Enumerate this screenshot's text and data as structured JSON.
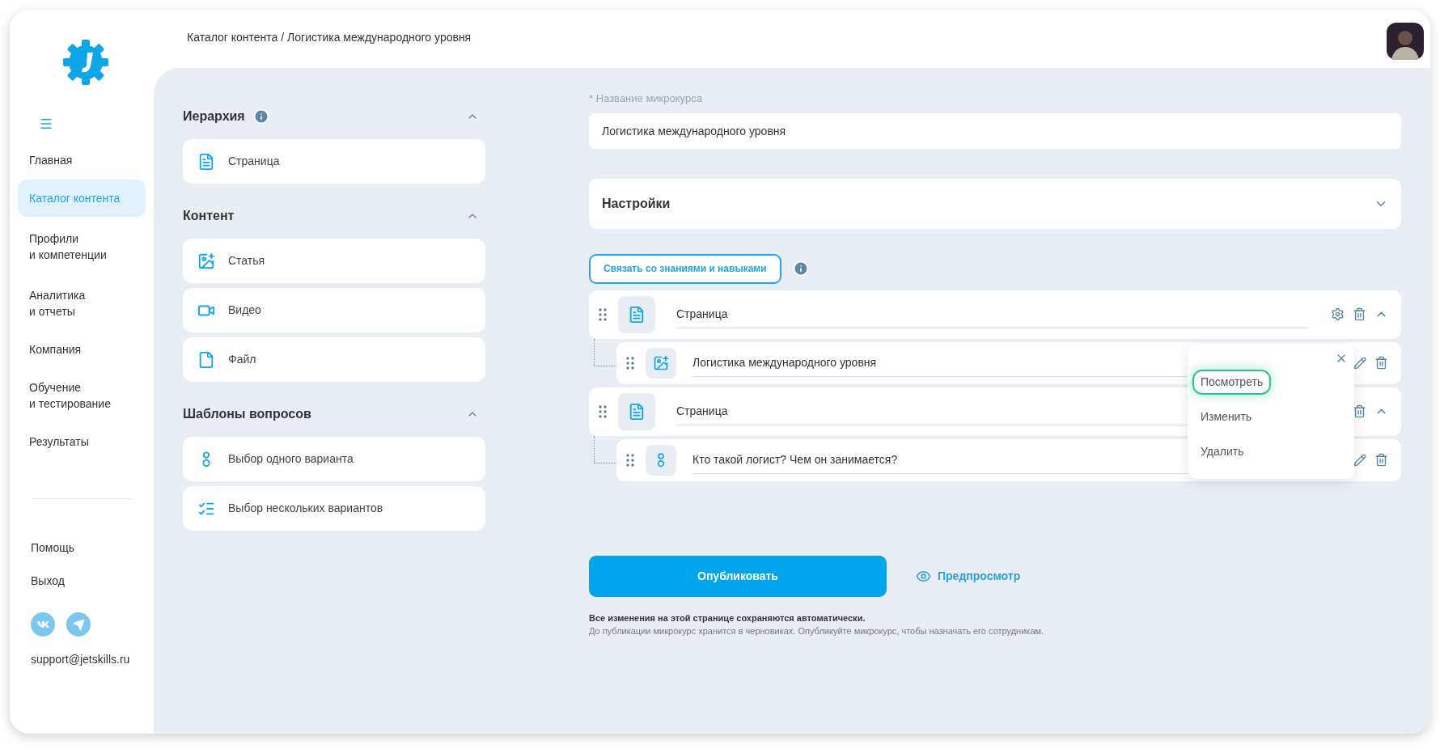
{
  "sidebar": {
    "menu": [
      {
        "label": "Главная",
        "selected": false
      },
      {
        "label": "Каталог контента",
        "selected": true
      },
      {
        "label": "Профили\nи компетенции",
        "selected": false
      },
      {
        "label": "Аналитика\nи отчеты",
        "selected": false
      },
      {
        "label": "Компания",
        "selected": false
      },
      {
        "label": "Обучение\nи тестирование",
        "selected": false
      },
      {
        "label": "Результаты",
        "selected": false
      }
    ],
    "footer_links": [
      "Помощь",
      "Выход"
    ],
    "email": "support@jetskills.ru"
  },
  "breadcrumb": "Каталог контента / Логистика международного уровня",
  "palette": [
    {
      "title": "Иерархия",
      "info": true,
      "expanded": true,
      "items": [
        {
          "label": "Страница",
          "kind": "page"
        }
      ]
    },
    {
      "title": "Контент",
      "info": false,
      "expanded": true,
      "items": [
        {
          "label": "Статья",
          "kind": "article"
        },
        {
          "label": "Видео",
          "kind": "video"
        },
        {
          "label": "Файл",
          "kind": "file"
        }
      ]
    },
    {
      "title": "Шаблоны вопросов",
      "info": false,
      "expanded": true,
      "items": [
        {
          "label": "Выбор одного варианта",
          "kind": "single"
        },
        {
          "label": "Выбор нескольких вариантов",
          "kind": "multi"
        }
      ]
    }
  ],
  "form": {
    "field_label": "Название микрокурса",
    "required_mark": "*",
    "field_value": "Логистика международного уровня",
    "settings": {
      "title": "Настройки",
      "expanded": false
    },
    "link_button": "Связать со знаниями и навыками",
    "structure": [
      {
        "kind": "page",
        "title": "Страница",
        "expanded": true,
        "settings": true,
        "children": [
          {
            "kind": "article",
            "title": "Логистика международного уровня"
          }
        ]
      },
      {
        "kind": "page",
        "title": "Страница",
        "expanded": true,
        "settings": false,
        "children": [
          {
            "kind": "single",
            "title": "Кто такой логист? Чем он занимается?"
          }
        ]
      }
    ]
  },
  "context_menu": {
    "items": [
      {
        "label": "Посмотреть",
        "selected": true
      },
      {
        "label": "Изменить",
        "selected": false
      },
      {
        "label": "Удалить",
        "selected": false
      }
    ]
  },
  "publish_button": "Опубликовать",
  "preview_link": "Предпросмотр",
  "notes": [
    "Все изменения на этой странице сохраняются автоматически.",
    "До публикации микрокурс хранится в черновиках. Опубликуйте микрокурс, чтобы назначать его сотрудникам."
  ]
}
